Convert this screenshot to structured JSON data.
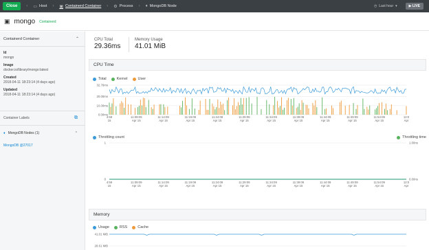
{
  "topbar": {
    "close_label": "Close",
    "breadcrumbs": [
      {
        "label": "Host",
        "icon": "host-icon"
      },
      {
        "label": "Containerd Container",
        "icon": "container-icon"
      },
      {
        "label": "Process",
        "icon": "process-icon"
      },
      {
        "label": "MongoDB Node",
        "icon": "leaf-icon"
      }
    ],
    "time_range": "Last hour",
    "live_label": "LIVE"
  },
  "title": {
    "name": "mongo",
    "subtitle": "Containerd"
  },
  "sidebar": {
    "panel_title": "Containerd Container",
    "props": [
      {
        "key": "Id",
        "value": "mongo"
      },
      {
        "key": "Image",
        "value": "docker.io/library/mongo:latest"
      },
      {
        "key": "Created",
        "value": "2018-04-11 18:23:14 (4 days ago)"
      },
      {
        "key": "Updated",
        "value": "2018-04-11 18:23:14 (4 days ago)"
      }
    ],
    "labels_title": "Container Labels",
    "nodes_title": "MongoDB Nodes (1)",
    "node_link": "MongoDB @27017"
  },
  "metrics": {
    "cpu_label": "CPU Total",
    "cpu_value": "29.36ms",
    "mem_label": "Memory Usage",
    "mem_value": "41.01 MiB"
  },
  "cpu_section": {
    "title": "CPU Time",
    "legend": [
      {
        "name": "Total",
        "color": "#3a9ad9"
      },
      {
        "name": "Kernel",
        "color": "#59b25c"
      },
      {
        "name": "User",
        "color": "#ee9a3a"
      }
    ],
    "throttle_legend_left": "Throttling count",
    "throttle_legend_right": "Throttling time"
  },
  "memory_section": {
    "title": "Memory",
    "legend": [
      {
        "name": "Usage",
        "color": "#3a9ad9"
      },
      {
        "name": "RSS",
        "color": "#59b25c"
      },
      {
        "name": "Cache",
        "color": "#ee9a3a"
      }
    ]
  },
  "chart_data": [
    {
      "type": "line",
      "title": "CPU Time",
      "y_ticks": [
        "32.76ms",
        "20.00ms",
        "10.00ms",
        "0.00ms"
      ],
      "x_ticks": [
        "4:59",
        "11:09:09",
        "11:14:09",
        "11:19:09",
        "11:24:09",
        "11:29:09",
        "11:34:09",
        "11:39:09",
        "11:44:09",
        "11:49:09",
        "11:54:09",
        "12:0"
      ],
      "x_subticks": [
        "15",
        "Apr 15",
        "Apr 15",
        "Apr 15",
        "Apr 15",
        "Apr 15",
        "Apr 15",
        "Apr 15",
        "Apr 15",
        "Apr 15",
        "Apr 15",
        "Apr"
      ],
      "ylim": [
        0,
        32.76
      ],
      "series": [
        {
          "name": "Total",
          "mean": 27,
          "range": [
            22,
            32
          ]
        },
        {
          "name": "Kernel",
          "range": [
            0,
            20
          ]
        },
        {
          "name": "User",
          "range": [
            0,
            20
          ]
        }
      ]
    },
    {
      "type": "line",
      "y_left_ticks": [
        "1",
        "0"
      ],
      "y_right_ticks": [
        "1.00ns",
        "0.00ns"
      ],
      "x_ticks": [
        "4:59",
        "11:09:09",
        "11:14:09",
        "11:19:09",
        "11:24:09",
        "11:29:09",
        "11:34:09",
        "11:39:09",
        "11:44:09",
        "11:49:09",
        "11:54:09",
        "12:0"
      ],
      "x_subticks": [
        "15",
        "Apr 15",
        "Apr 15",
        "Apr 15",
        "Apr 15",
        "Apr 15",
        "Apr 15",
        "Apr 15",
        "Apr 15",
        "Apr 15",
        "Apr 15",
        "Apr"
      ],
      "series": [
        {
          "name": "Throttling count",
          "value": 0
        },
        {
          "name": "Throttling time",
          "value": 0
        }
      ]
    },
    {
      "type": "line",
      "title": "Memory",
      "y_ticks": [
        "41.01 MiB",
        "28.61 MiB"
      ],
      "series": [
        {
          "name": "Usage",
          "value": 41.01
        }
      ]
    }
  ]
}
